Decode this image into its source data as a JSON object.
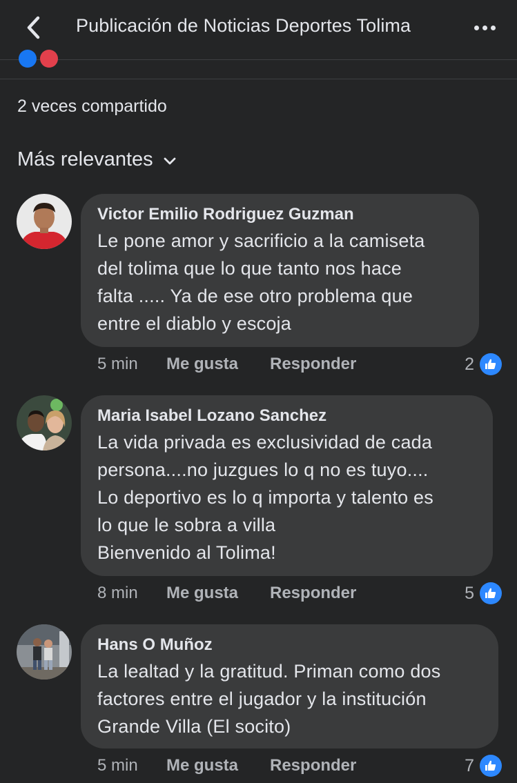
{
  "header": {
    "title": "Publicación de Noticias Deportes Tolima",
    "back_icon": "chevron-left-icon",
    "more_icon": "more-horizontal-icon"
  },
  "shares_text": "2 veces compartido",
  "sort_label": "Más relevantes",
  "colors": {
    "background": "#242526",
    "bubble": "#3a3b3c",
    "text": "#e4e6eb",
    "secondary_text": "#b0b3b8",
    "like_blue": "#2d88ff"
  },
  "comments": [
    {
      "author": "Victor Emilio Rodriguez Guzman",
      "lines": [
        "Le pone amor y sacrificio a la camiseta",
        "del tolima que lo que tanto nos hace",
        "falta ..... Ya de ese otro problema que",
        "entre el diablo y escoja"
      ],
      "time": "5 min",
      "like_label": "Me gusta",
      "reply_label": "Responder",
      "reactions": "2"
    },
    {
      "author": "Maria Isabel Lozano Sanchez",
      "lines": [
        "La vida privada es exclusividad de cada",
        "persona....no juzgues lo q no es tuyo....",
        "Lo deportivo es lo q importa y talento es",
        "lo que le sobra a villa",
        "Bienvenido al Tolima!"
      ],
      "time": "8 min",
      "like_label": "Me gusta",
      "reply_label": "Responder",
      "reactions": "5"
    },
    {
      "author": "Hans O Muñoz",
      "lines": [
        "La lealtad y la gratitud. Priman como dos",
        "factores entre el jugador y la institución",
        "Grande Villa (El socito)"
      ],
      "time": "5 min",
      "like_label": "Me gusta",
      "reply_label": "Responder",
      "reactions": "7"
    }
  ]
}
